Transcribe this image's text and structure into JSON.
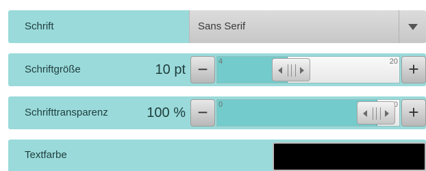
{
  "font": {
    "label": "Schrift",
    "selected": "Sans Serif"
  },
  "font_size": {
    "label": "Schriftgröße",
    "value_text": "10 pt",
    "minus_label": "−",
    "plus_label": "+",
    "min": "4",
    "max": "20",
    "value": 10
  },
  "font_transparency": {
    "label": "Schrifttransparenz",
    "value_text": "100 %",
    "minus_label": "−",
    "plus_label": "+",
    "min": "0",
    "max": "100",
    "value": 100
  },
  "text_color": {
    "label": "Textfarbe",
    "color": "#000000"
  },
  "colors": {
    "row_background": "#9adada",
    "slider_fill": "#73cbcb"
  }
}
